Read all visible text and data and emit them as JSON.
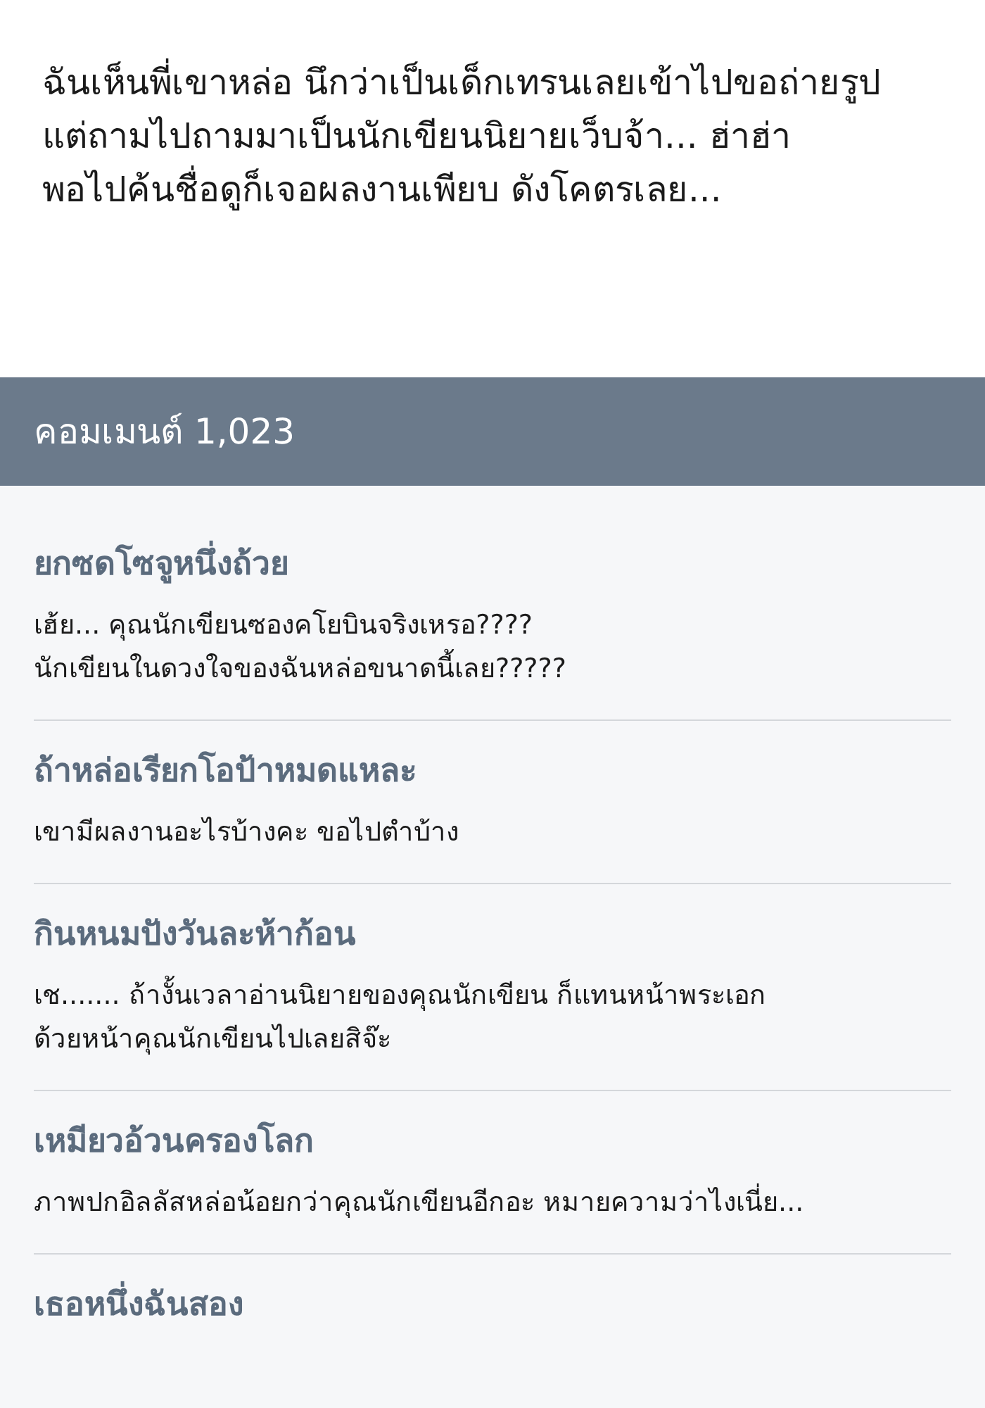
{
  "post": {
    "lines": [
      "ฉันเห็นพี่เขาหล่อ นึกว่าเป็นเด็กเทรนเลยเข้าไปขอถ่ายรูป",
      "แต่ถามไปถามมาเป็นนักเขียนนิยายเว็บจ้า... ฮ่าฮ่า",
      "พอไปค้นชื่อดูก็เจอผลงานเพียบ ดังโคตรเลย..."
    ]
  },
  "comments_header": {
    "title": "คอมเมนต์ 1,023"
  },
  "comments": [
    {
      "name": "ยกซดโซจูหนึ่งถ้วย",
      "lines": [
        "เฮ้ย... คุณนักเขียนซองคโยบินจริงเหรอ????",
        "นักเขียนในดวงใจของฉันหล่อขนาดนี้เลย?????"
      ]
    },
    {
      "name": "ถ้าหล่อเรียกโอป้าหมดแหละ",
      "lines": [
        "เขามีผลงานอะไรบ้างคะ ขอไปตำบ้าง"
      ]
    },
    {
      "name": "กินหนมปังวันละห้าก้อน",
      "lines": [
        "เช....... ถ้างั้นเวลาอ่านนิยายของคุณนักเขียน ก็แทนหน้าพระเอก",
        "ด้วยหน้าคุณนักเขียนไปเลยสิจ๊ะ"
      ]
    },
    {
      "name": "เหมียวอ้วนครองโลก",
      "lines": [
        "ภาพปกอิลลัสหล่อน้อยกว่าคุณนักเขียนอีกอะ หมายความว่าไงเนี่ย..."
      ]
    },
    {
      "name": "เธอหนึ่งฉันสอง"
    }
  ]
}
